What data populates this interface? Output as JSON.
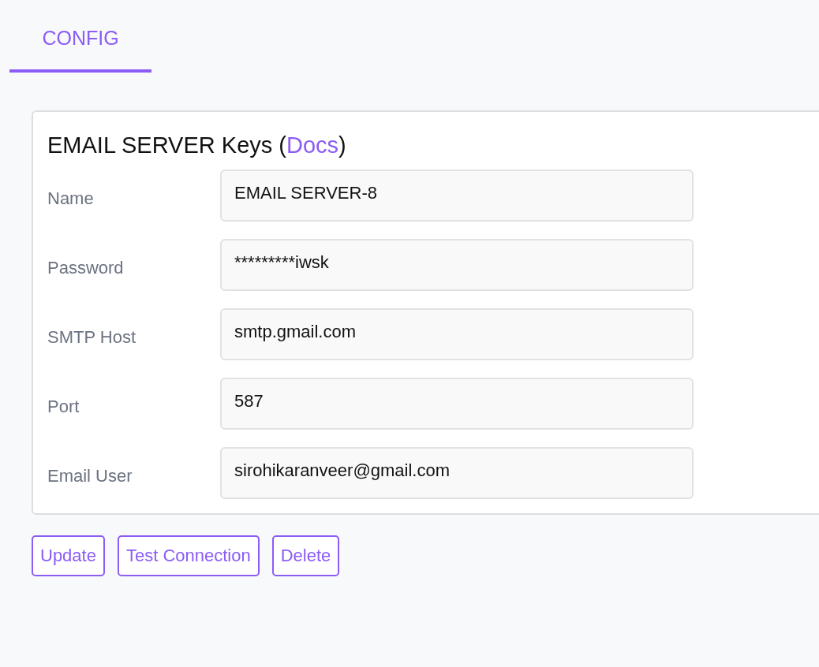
{
  "tabs": [
    {
      "label": "CONFIG",
      "selected": true
    }
  ],
  "card": {
    "title_before": "EMAIL SERVER Keys (",
    "title_link": "Docs",
    "title_after": ")",
    "fields": [
      {
        "label": "Name",
        "value": "EMAIL SERVER-8"
      },
      {
        "label": "Password",
        "value": "*********iwsk"
      },
      {
        "label": "SMTP Host",
        "value": "smtp.gmail.com"
      },
      {
        "label": "Port",
        "value": "587"
      },
      {
        "label": "Email User",
        "value": "sirohikaranveer@gmail.com"
      }
    ]
  },
  "buttons": [
    "Update",
    "Test Connection",
    "Delete"
  ]
}
